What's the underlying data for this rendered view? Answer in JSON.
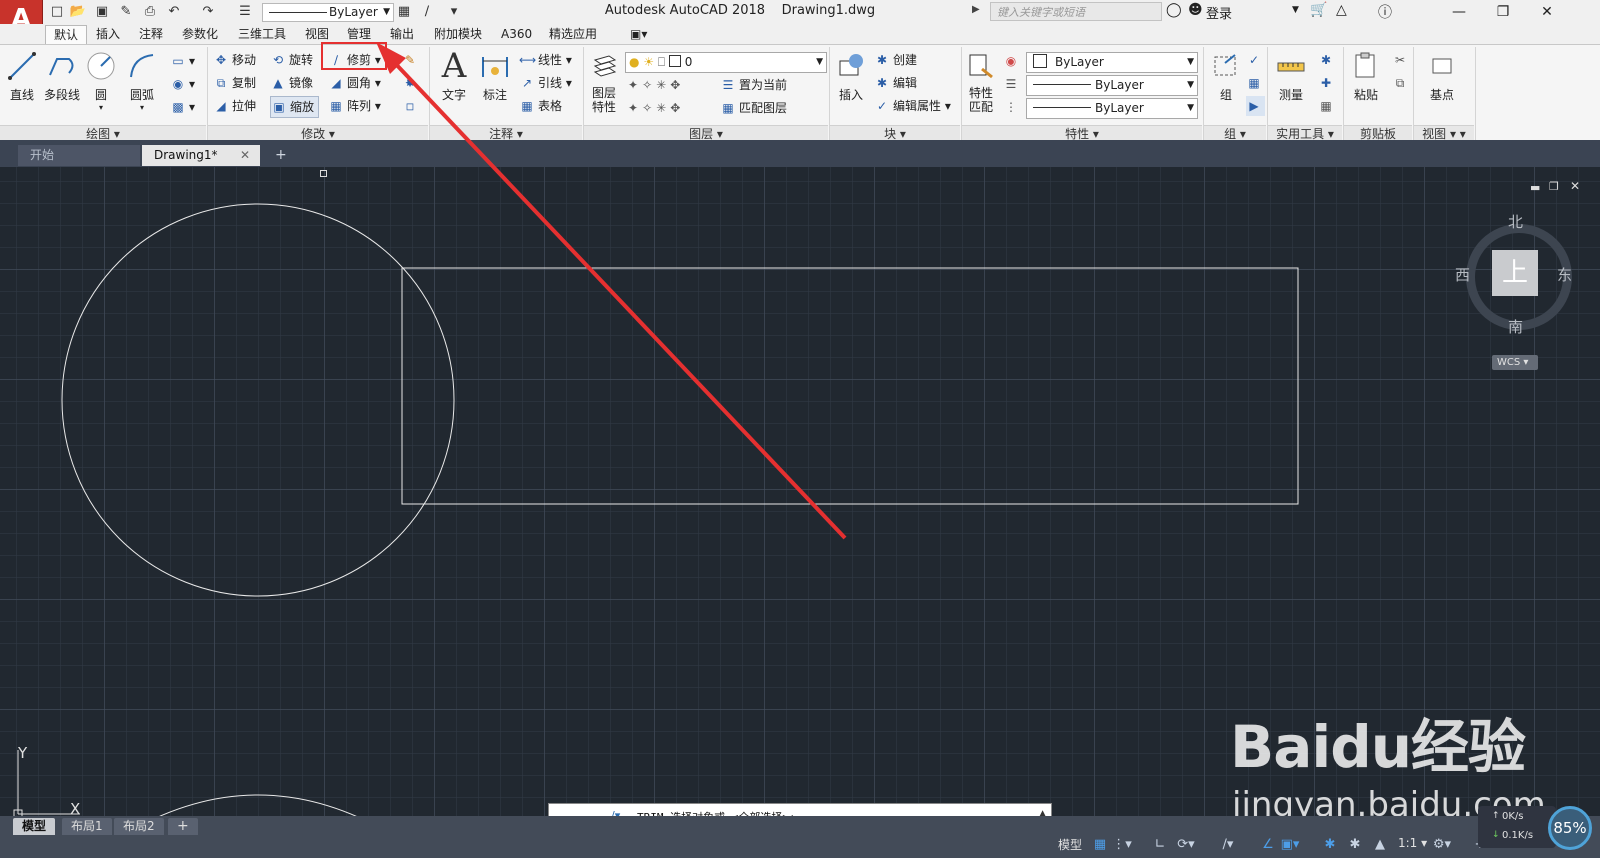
{
  "app": {
    "logo_letter": "A",
    "title": "Autodesk AutoCAD 2018    Drawing1.dwg",
    "search_placeholder": "键入关键字或短语",
    "login_label": "登录"
  },
  "quick_access": {
    "layer_value": "ByLayer"
  },
  "ribbon_tabs": [
    "默认",
    "插入",
    "注释",
    "参数化",
    "三维工具",
    "视图",
    "管理",
    "输出",
    "附加模块",
    "A360",
    "精选应用"
  ],
  "ribbon": {
    "draw": {
      "title": "绘图",
      "line": "直线",
      "polyline": "多段线",
      "circle": "圆",
      "arc": "圆弧"
    },
    "modify": {
      "title": "修改",
      "move": "移动",
      "rotate": "旋转",
      "trim": "修剪",
      "copy": "复制",
      "mirror": "镜像",
      "fillet": "圆角",
      "stretch": "拉伸",
      "scale": "缩放",
      "array": "阵列"
    },
    "annotation": {
      "title": "注释",
      "text": "文字",
      "dimension": "标注",
      "linear": "线性",
      "leader": "引线",
      "table": "表格"
    },
    "layers": {
      "title": "图层",
      "layer_props_1": "图层",
      "layer_props_2": "特性",
      "current_layer": "0",
      "set_current": "置为当前",
      "match_layer": "匹配图层"
    },
    "block": {
      "title": "块",
      "insert": "插入",
      "create": "创建",
      "edit": "编辑",
      "edit_attr": "编辑属性"
    },
    "properties": {
      "title": "特性",
      "match_1": "特性",
      "match_2": "匹配",
      "color": "ByLayer",
      "linetype": "ByLayer",
      "lineweight": "ByLayer"
    },
    "groups": {
      "title": "组",
      "group": "组"
    },
    "utilities": {
      "title": "实用工具",
      "measure": "测量"
    },
    "clipboard": {
      "title": "剪贴板",
      "paste": "粘贴"
    },
    "view": {
      "title": "视图",
      "base": "基点"
    }
  },
  "file_tabs": [
    "开始",
    "Drawing1*"
  ],
  "viewcube": {
    "north": "北",
    "south": "南",
    "east": "东",
    "west": "西",
    "top": "上",
    "wcs": "WCS"
  },
  "ucs": {
    "x": "X",
    "y": "Y"
  },
  "command_line": "TRIM 选择对象或 <全部选择>:",
  "layout_tabs": [
    "模型",
    "布局1",
    "布局2"
  ],
  "status": {
    "model": "模型",
    "scale": "1:1",
    "net_up": "0K/s",
    "net_down": "0.1K/s",
    "percent": "85%"
  },
  "watermark": {
    "brand": "Baidu经验",
    "url": "jingyan.baidu.com"
  },
  "colors": {
    "canvas": "#212830",
    "annotation_arrow": "#e53030",
    "logo_red": "#c8332b"
  }
}
